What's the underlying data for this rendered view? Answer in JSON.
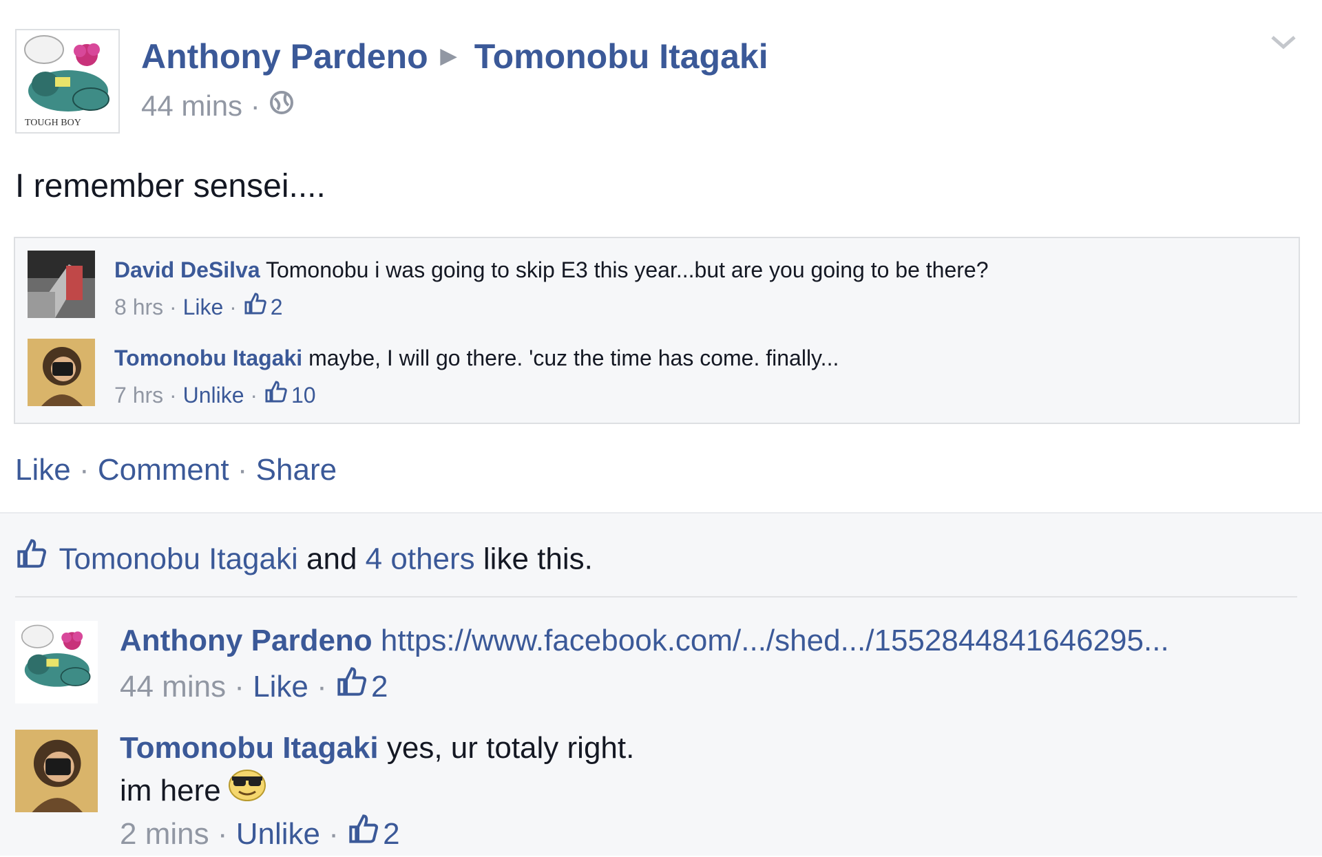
{
  "post": {
    "author": "Anthony Pardeno",
    "target": "Tomonobu Itagaki",
    "time": "44 mins",
    "separator": "·",
    "text": "I remember sensei....",
    "avatar_caption": "TOUGH BOY"
  },
  "shared": {
    "comments": [
      {
        "author": "David DeSilva",
        "text": "Tomonobu i was going to skip E3 this year...but are you going to be there?",
        "time": "8 hrs",
        "action": "Like",
        "likes": "2"
      },
      {
        "author": "Tomonobu Itagaki",
        "text": "maybe, I will go there. 'cuz the time has come. finally...",
        "time": "7 hrs",
        "action": "Unlike",
        "likes": "10"
      }
    ]
  },
  "actions": {
    "like": "Like",
    "comment": "Comment",
    "share": "Share"
  },
  "likes_summary": {
    "name": "Tomonobu Itagaki",
    "and": "and",
    "others": "4 others",
    "suffix": "like this."
  },
  "comments": [
    {
      "author": "Anthony Pardeno",
      "text": "https://www.facebook.com/.../shed.../1552844841646295...",
      "time": "44 mins",
      "action": "Like",
      "likes": "2"
    },
    {
      "author": "Tomonobu Itagaki",
      "text": "yes, ur totaly right.",
      "text2": "im here",
      "time": "2 mins",
      "action": "Unlike",
      "likes": "2"
    }
  ],
  "colors": {
    "link": "#3b5998",
    "muted": "#9197a3",
    "background": "#f6f7f9"
  },
  "icons": [
    "arrow-right-icon",
    "globe-icon",
    "chevron-down-icon",
    "thumbs-up-icon",
    "sunglasses-emoji-icon"
  ]
}
